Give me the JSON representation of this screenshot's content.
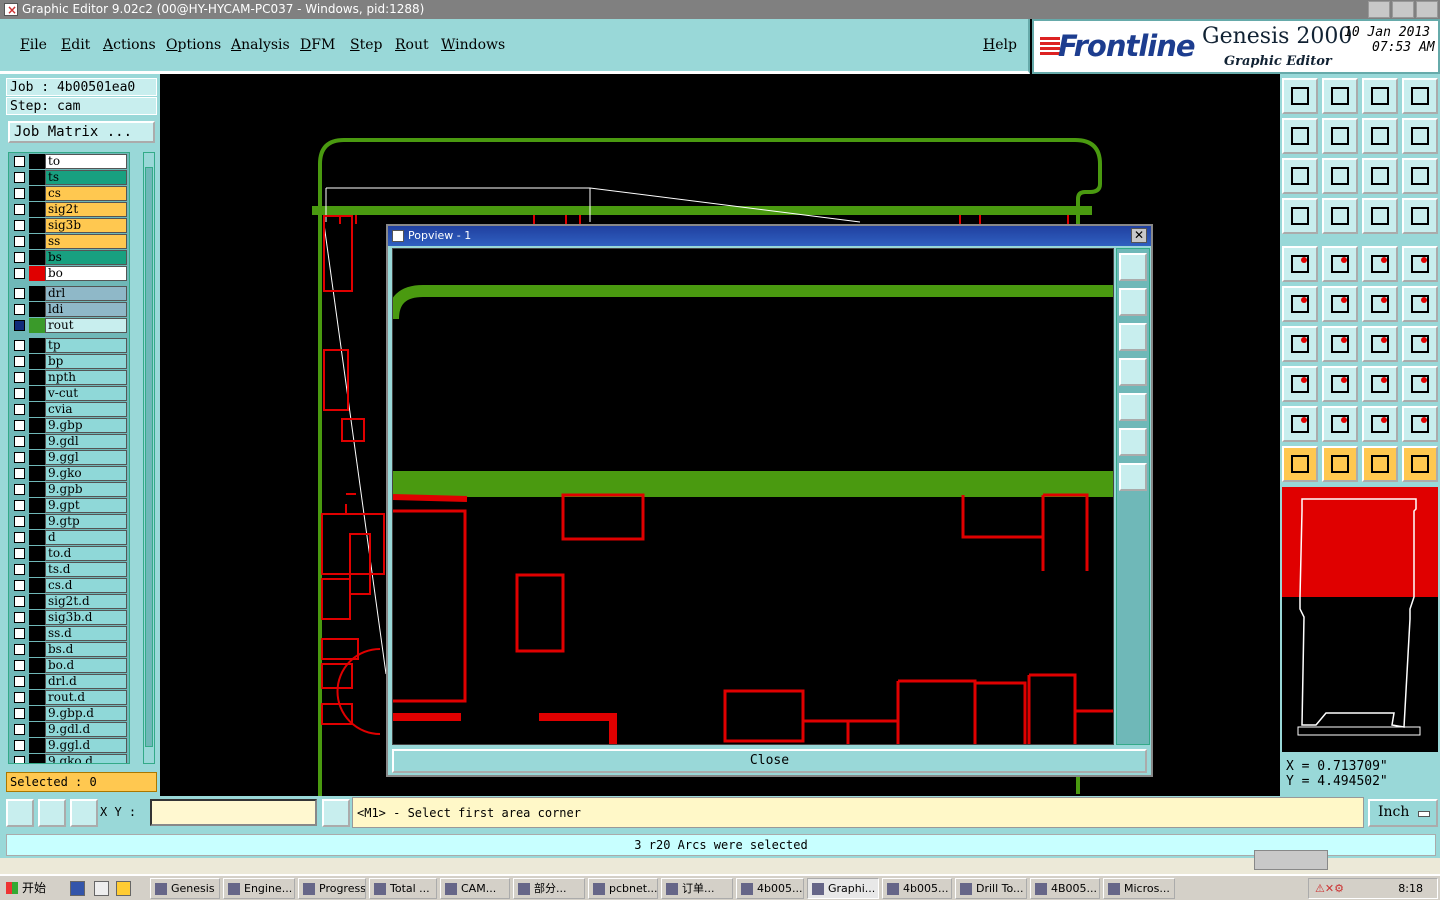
{
  "window": {
    "title": "Graphic Editor 9.02c2 (00@HY-HYCAM-PC037 - Windows, pid:1288)"
  },
  "menu": {
    "items": [
      "File",
      "Edit",
      "Actions",
      "Options",
      "Analysis",
      "DFM",
      "Step",
      "Rout",
      "Windows"
    ],
    "help": "Help"
  },
  "brand": {
    "logo": "Frontline",
    "product": "Genesis 2000",
    "subtitle": "Graphic Editor",
    "date": "10 Jan 2013",
    "time": "07:53 AM"
  },
  "job": {
    "job_label": "Job : 4b00501ea0",
    "step_label": "Step: cam",
    "matrix_button": "Job Matrix ..."
  },
  "layers": [
    {
      "name": "to",
      "color": "#ffffff",
      "dot": "#000000"
    },
    {
      "name": "ts",
      "color": "#18a080",
      "dot": "#000000"
    },
    {
      "name": "cs",
      "color": "#ffc850",
      "dot": "#000000"
    },
    {
      "name": "sig2t",
      "color": "#ffc850",
      "dot": "#000000"
    },
    {
      "name": "sig3b",
      "color": "#ffc850",
      "dot": "#000000"
    },
    {
      "name": "ss",
      "color": "#ffc850",
      "dot": "#000000"
    },
    {
      "name": "bs",
      "color": "#18a080",
      "dot": "#000000"
    },
    {
      "name": "bo",
      "color": "#ffffff",
      "dot": "#e00000"
    },
    {
      "gap": true
    },
    {
      "name": "drl",
      "color": "#8fb8c8",
      "dot": "#000000"
    },
    {
      "name": "ldi",
      "color": "#8fb8c8",
      "dot": "#000000"
    },
    {
      "name": "rout",
      "color": "#c8eeee",
      "dot": "#3a9a2a",
      "selected": true
    },
    {
      "gap": true
    },
    {
      "name": "tp",
      "color": "#8fd8d8",
      "dot": "#000000"
    },
    {
      "name": "bp",
      "color": "#8fd8d8",
      "dot": "#000000"
    },
    {
      "name": "npth",
      "color": "#8fd8d8",
      "dot": "#000000"
    },
    {
      "name": "v-cut",
      "color": "#8fd8d8",
      "dot": "#000000"
    },
    {
      "name": "cvia",
      "color": "#8fd8d8",
      "dot": "#000000"
    },
    {
      "name": "9.gbp",
      "color": "#8fd8d8",
      "dot": "#000000"
    },
    {
      "name": "9.gdl",
      "color": "#8fd8d8",
      "dot": "#000000"
    },
    {
      "name": "9.ggl",
      "color": "#8fd8d8",
      "dot": "#000000"
    },
    {
      "name": "9.gko",
      "color": "#8fd8d8",
      "dot": "#000000"
    },
    {
      "name": "9.gpb",
      "color": "#8fd8d8",
      "dot": "#000000"
    },
    {
      "name": "9.gpt",
      "color": "#8fd8d8",
      "dot": "#000000"
    },
    {
      "name": "9.gtp",
      "color": "#8fd8d8",
      "dot": "#000000"
    },
    {
      "name": "d",
      "color": "#8fd8d8",
      "dot": "#000000"
    },
    {
      "name": "to.d",
      "color": "#8fd8d8",
      "dot": "#000000"
    },
    {
      "name": "ts.d",
      "color": "#8fd8d8",
      "dot": "#000000"
    },
    {
      "name": "cs.d",
      "color": "#8fd8d8",
      "dot": "#000000"
    },
    {
      "name": "sig2t.d",
      "color": "#8fd8d8",
      "dot": "#000000"
    },
    {
      "name": "sig3b.d",
      "color": "#8fd8d8",
      "dot": "#000000"
    },
    {
      "name": "ss.d",
      "color": "#8fd8d8",
      "dot": "#000000"
    },
    {
      "name": "bs.d",
      "color": "#8fd8d8",
      "dot": "#000000"
    },
    {
      "name": "bo.d",
      "color": "#8fd8d8",
      "dot": "#000000"
    },
    {
      "name": "drl.d",
      "color": "#8fd8d8",
      "dot": "#000000"
    },
    {
      "name": "rout.d",
      "color": "#8fd8d8",
      "dot": "#000000"
    },
    {
      "name": "9.gbp.d",
      "color": "#8fd8d8",
      "dot": "#000000"
    },
    {
      "name": "9.gdl.d",
      "color": "#8fd8d8",
      "dot": "#000000"
    },
    {
      "name": "9.ggl.d",
      "color": "#8fd8d8",
      "dot": "#000000"
    },
    {
      "name": "9.gko.d",
      "color": "#8fd8d8",
      "dot": "#000000"
    }
  ],
  "selected_label": "Selected : 0",
  "popview": {
    "title": "Popview - 1",
    "close_button": "Close"
  },
  "coords": {
    "x": "X = 0.713709\"",
    "y": "Y = 4.494502\""
  },
  "command": {
    "xy_label": "X Y :",
    "prompt": "<M1> - Select first area corner",
    "unit": "Inch"
  },
  "status": {
    "message": "3 r20 Arcs were selected"
  },
  "taskbar": {
    "start": "开始",
    "tasks": [
      "Genesis",
      "Engine...",
      "Progress",
      "Total ...",
      "CAM...",
      "部分...",
      "pcbnet...",
      "订单...",
      "4b005...",
      "Graphi...",
      "4b005...",
      "Drill To...",
      "4B005...",
      "Micros..."
    ],
    "active_index": 9,
    "clock": "8:18"
  },
  "colors": {
    "panel": "#99d8d8",
    "route_green": "#4a9a10",
    "board_red": "#e00000",
    "accent_orange": "#ffc850"
  }
}
